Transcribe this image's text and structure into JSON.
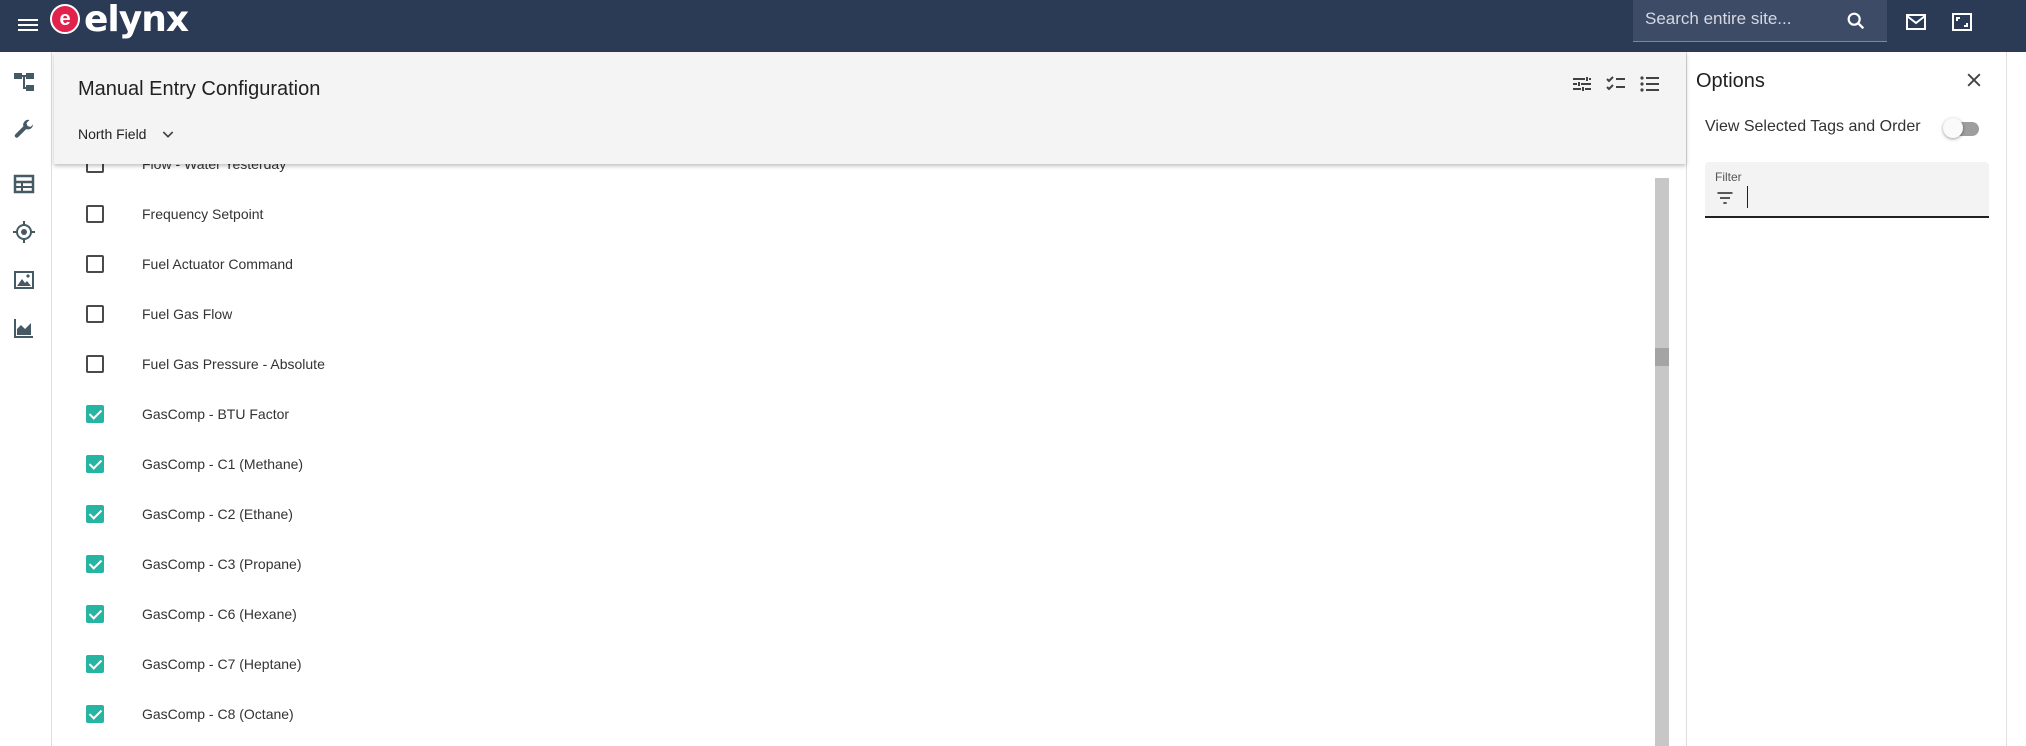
{
  "app": {
    "logo_mark": "e",
    "logo_text": "elynx"
  },
  "search": {
    "placeholder": "Search entire site..."
  },
  "header": {
    "title": "Manual Entry Configuration",
    "site": "North Field"
  },
  "tags": [
    {
      "label": "Flow - Water Yesterday",
      "checked": false
    },
    {
      "label": "Frequency Setpoint",
      "checked": false
    },
    {
      "label": "Fuel Actuator Command",
      "checked": false
    },
    {
      "label": "Fuel Gas Flow",
      "checked": false
    },
    {
      "label": "Fuel Gas Pressure - Absolute",
      "checked": false
    },
    {
      "label": "GasComp - BTU Factor",
      "checked": true
    },
    {
      "label": "GasComp - C1 (Methane)",
      "checked": true
    },
    {
      "label": "GasComp - C2 (Ethane)",
      "checked": true
    },
    {
      "label": "GasComp - C3 (Propane)",
      "checked": true
    },
    {
      "label": "GasComp - C6 (Hexane)",
      "checked": true
    },
    {
      "label": "GasComp - C7 (Heptane)",
      "checked": true
    },
    {
      "label": "GasComp - C8 (Octane)",
      "checked": true
    }
  ],
  "options": {
    "title": "Options",
    "toggle_label": "View Selected Tags and Order",
    "toggle_on": false,
    "filter_label": "Filter",
    "filter_value": ""
  },
  "colors": {
    "topbar": "#2b3a55",
    "accent_check": "#26b5a2",
    "brand": "#e0224c"
  },
  "icons": {
    "nav": [
      "hierarchy-icon",
      "wrench-icon",
      "table-icon",
      "location-target-icon",
      "image-icon",
      "area-chart-icon"
    ],
    "header": [
      "tune-icon",
      "checklist-icon",
      "list-icon"
    ]
  }
}
